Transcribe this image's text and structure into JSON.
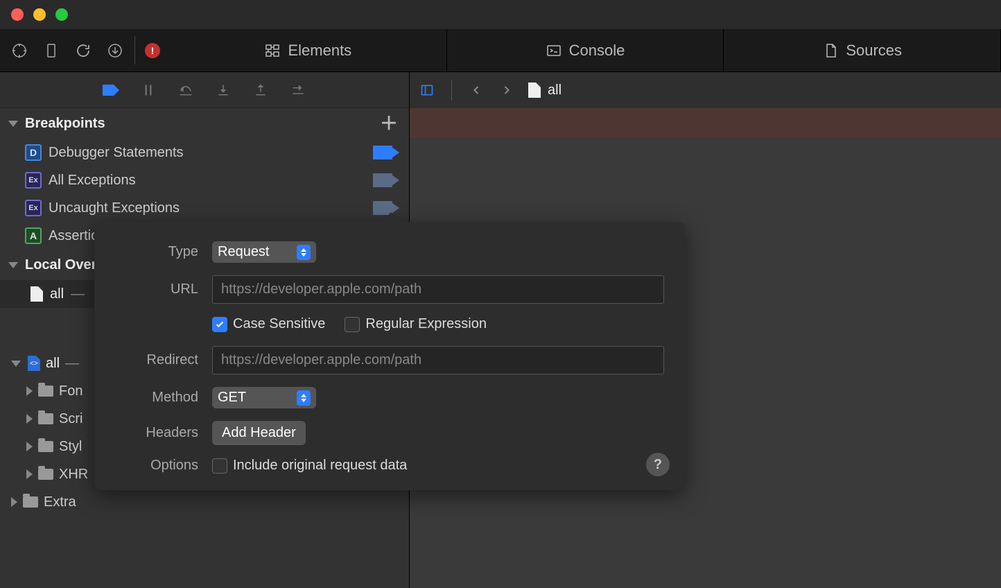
{
  "tabs": {
    "elements": "Elements",
    "console": "Console",
    "sources": "Sources"
  },
  "sidebar": {
    "breakpoints": {
      "title": "Breakpoints",
      "items": {
        "debugger": "Debugger Statements",
        "allExceptions": "All Exceptions",
        "uncaught": "Uncaught Exceptions",
        "assertion": "Assertion Failures"
      }
    },
    "localOverrides": {
      "title": "Local Overrides",
      "item": {
        "primary": "all",
        "secondary": " — "
      }
    },
    "tree": {
      "root": {
        "primary": "all",
        "secondary": " — "
      },
      "children": {
        "fonts": "Fon",
        "scripts": "Scri",
        "styles": "Styl",
        "xhrs": "XHR",
        "extra": "Extra"
      }
    }
  },
  "fileNav": {
    "filename": "all"
  },
  "popover": {
    "labels": {
      "type": "Type",
      "url": "URL",
      "redirect": "Redirect",
      "method": "Method",
      "headers": "Headers",
      "options": "Options"
    },
    "typeValue": "Request",
    "urlPlaceholder": "https://developer.apple.com/path",
    "caseSensitive": "Case Sensitive",
    "regex": "Regular Expression",
    "redirectPlaceholder": "https://developer.apple.com/path",
    "methodValue": "GET",
    "addHeader": "Add Header",
    "includeOriginal": "Include original request data",
    "help": "?"
  },
  "errorBadge": "!"
}
